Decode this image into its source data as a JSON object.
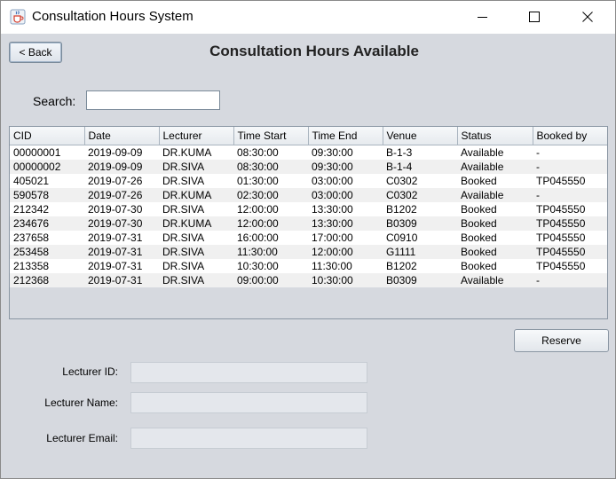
{
  "window": {
    "title": "Consultation Hours System"
  },
  "back_label": "< Back",
  "heading": "Consultation Hours Available",
  "search": {
    "label": "Search:",
    "value": ""
  },
  "table": {
    "columns": [
      "CID",
      "Date",
      "Lecturer",
      "Time Start",
      "Time End",
      "Venue",
      "Status",
      "Booked by"
    ],
    "rows": [
      [
        "00000001",
        "2019-09-09",
        "DR.KUMA",
        "08:30:00",
        "09:30:00",
        "B-1-3",
        "Available",
        "-"
      ],
      [
        "00000002",
        "2019-09-09",
        "DR.SIVA",
        "08:30:00",
        "09:30:00",
        "B-1-4",
        "Available",
        "-"
      ],
      [
        "405021",
        "2019-07-26",
        "DR.SIVA",
        "01:30:00",
        "03:00:00",
        "C0302",
        "Booked",
        "TP045550"
      ],
      [
        "590578",
        "2019-07-26",
        "DR.KUMA",
        "02:30:00",
        "03:00:00",
        "C0302",
        "Available",
        "-"
      ],
      [
        "212342",
        "2019-07-30",
        "DR.SIVA",
        "12:00:00",
        "13:30:00",
        "B1202",
        "Booked",
        "TP045550"
      ],
      [
        "234676",
        "2019-07-30",
        "DR.KUMA",
        "12:00:00",
        "13:30:00",
        "B0309",
        "Booked",
        "TP045550"
      ],
      [
        "237658",
        "2019-07-31",
        "DR.SIVA",
        "16:00:00",
        "17:00:00",
        "C0910",
        "Booked",
        "TP045550"
      ],
      [
        "253458",
        "2019-07-31",
        "DR.SIVA",
        "11:30:00",
        "12:00:00",
        "G1111",
        "Booked",
        "TP045550"
      ],
      [
        "213358",
        "2019-07-31",
        "DR.SIVA",
        "10:30:00",
        "11:30:00",
        "B1202",
        "Booked",
        "TP045550"
      ],
      [
        "212368",
        "2019-07-31",
        "DR.SIVA",
        "09:00:00",
        "10:30:00",
        "B0309",
        "Available",
        "-"
      ]
    ]
  },
  "reserve_label": "Reserve",
  "form": {
    "lecturer_id_label": "Lecturer ID:",
    "lecturer_id_value": "",
    "lecturer_name_label": "Lecturer Name:",
    "lecturer_name_value": "",
    "lecturer_email_label": "Lecturer Email:",
    "lecturer_email_value": ""
  },
  "icons": {
    "app": "java-cup-icon",
    "minimize": "minimize-icon",
    "maximize": "maximize-icon",
    "close": "close-icon"
  }
}
